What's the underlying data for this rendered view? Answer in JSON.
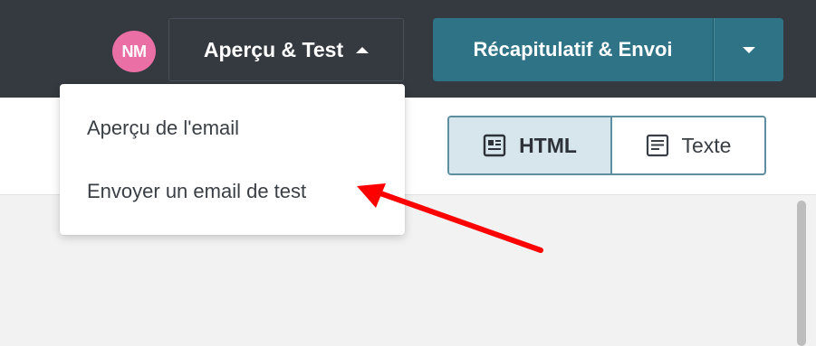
{
  "header": {
    "avatar_initials": "NM",
    "preview_button_label": "Aperçu & Test",
    "recap_button_label": "Récapitulatif & Envoi"
  },
  "preview_menu": {
    "items": [
      {
        "label": "Aperçu de l'email"
      },
      {
        "label": "Envoyer un email de test"
      }
    ]
  },
  "view_toggle": {
    "options": [
      {
        "label": "HTML",
        "icon": "newspaper-icon",
        "selected": true
      },
      {
        "label": "Texte",
        "icon": "text-document-icon",
        "selected": false
      }
    ]
  },
  "colors": {
    "topbar": "#353a40",
    "accent": "#2e7386",
    "avatar": "#ea6fa5",
    "annotation_arrow": "#ff0000",
    "toggle_selected": "#d7e6ec"
  }
}
